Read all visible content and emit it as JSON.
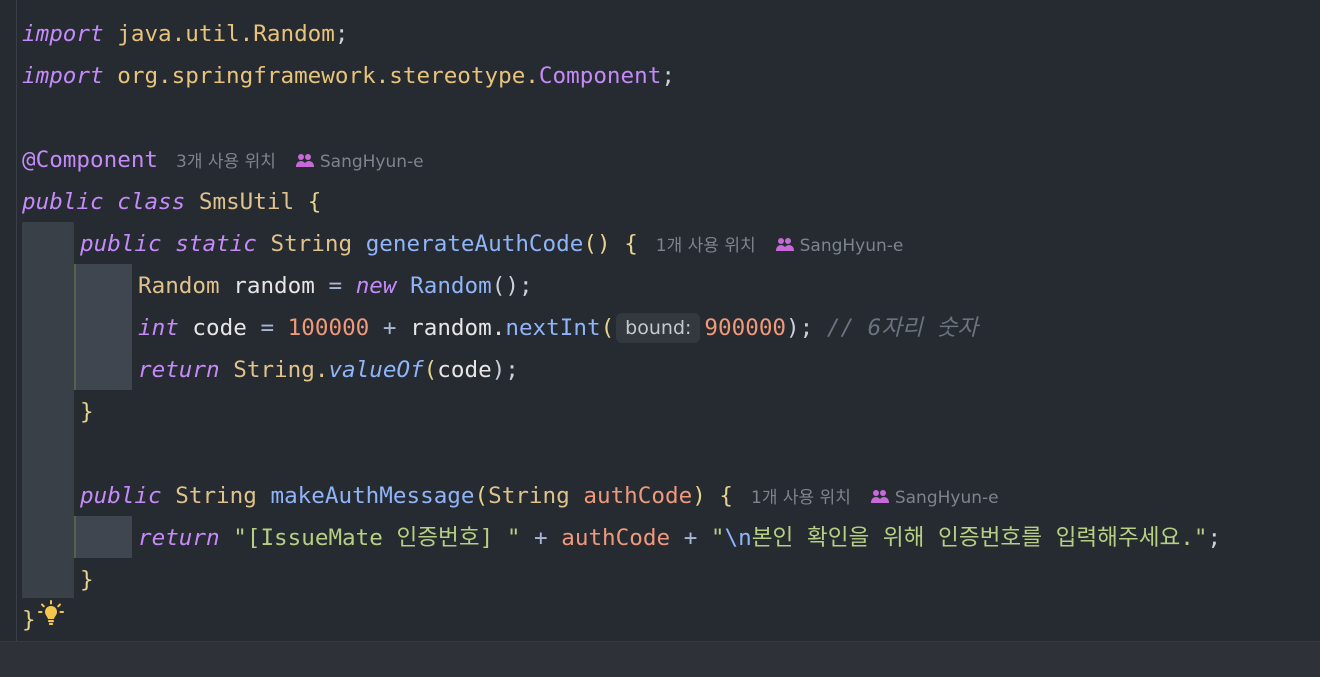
{
  "code": {
    "l1": {
      "kw": "import",
      "pkg": "java.util.",
      "cls": "Random",
      "end": ";"
    },
    "l2": {
      "kw": "import",
      "pkg": "org.springframework.stereotype.",
      "cls": "Component",
      "end": ";"
    },
    "l4": {
      "ann": "@Component",
      "usages": "3개 사용 위치",
      "author": "SangHyun-e"
    },
    "l5": {
      "kw1": "public",
      "kw2": "class",
      "name": "SmsUtil",
      "brace": "{"
    },
    "l6": {
      "kw1": "public",
      "kw2": "static",
      "type": "String",
      "fn": "generateAuthCode",
      "parens": "()",
      "brace": "{",
      "usages": "1개 사용 위치",
      "author": "SangHyun-e"
    },
    "l7": {
      "type": "Random",
      "var": "random",
      "op": "=",
      "kw": "new",
      "ctor": "Random",
      "tail": "();"
    },
    "l8": {
      "kw": "int",
      "var": "code",
      "op": "=",
      "num1": "100000",
      "plus": "+",
      "obj": "random.",
      "fn": "nextInt",
      "open": "(",
      "hint": "bound:",
      "num2": "900000",
      "close": ");",
      "comment": "// 6자리 숫자"
    },
    "l9": {
      "kw": "return",
      "cls": "String.",
      "fn": "valueOf",
      "open": "(",
      "arg": "code",
      "close": ");"
    },
    "l10": {
      "brace": "}"
    },
    "l12": {
      "kw": "public",
      "type": "String",
      "fn": "makeAuthMessage",
      "open": "(",
      "ptype": "String",
      "pname": "authCode",
      "close": ")",
      "brace": "{",
      "usages": "1개 사용 위치",
      "author": "SangHyun-e"
    },
    "l13": {
      "kw": "return",
      "str1": "\"[IssueMate 인증번호] \"",
      "plus1": "+",
      "var": "authCode",
      "plus2": "+",
      "str2a": "\"",
      "esc": "\\n",
      "str2b": "본인 확인을 위해 인증번호를 입력해주세요.\"",
      "end": ";"
    },
    "l14": {
      "brace": "}"
    },
    "l15": {
      "brace": "}"
    }
  },
  "icons": {
    "author": "user-group-icon",
    "intention": "lightbulb-icon"
  },
  "colors": {
    "background": "#262a31",
    "keyword": "#c58af9",
    "string": "#b7cf83",
    "number": "#f0997a",
    "function": "#8fb4f8"
  }
}
